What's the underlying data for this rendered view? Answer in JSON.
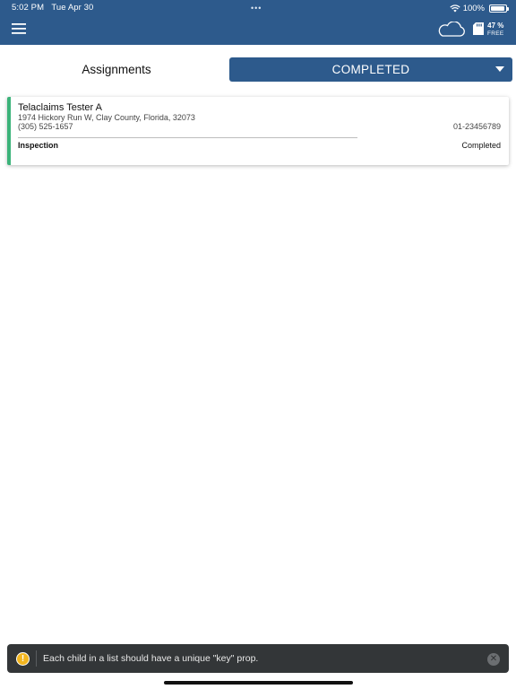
{
  "status_bar": {
    "time": "5:02 PM",
    "date": "Tue Apr 30",
    "battery": "100%",
    "wifi_icon": "wifi-icon",
    "battery_icon": "battery-icon"
  },
  "header": {
    "menu_icon": "hamburger-menu-icon",
    "cloud_icon": "cloud-sync-icon",
    "storage_icon": "sd-card-icon",
    "storage_percent": "47 %",
    "storage_label": "FREE"
  },
  "filters": {
    "assignments_label": "Assignments",
    "selected_status": "COMPLETED"
  },
  "assignments": [
    {
      "name": "Telaclaims Tester A",
      "address": "1974 Hickory Run W, Clay County, Florida, 32073",
      "phone": "(305) 525-1657",
      "claim_number": "01-23456789",
      "type": "Inspection",
      "status": "Completed"
    }
  ],
  "toast": {
    "icon": "warning-icon",
    "message": "Each child in a list should have a unique \"key\" prop.",
    "close_icon": "close-icon"
  },
  "colors": {
    "primary": "#2d5a8c",
    "card_accent": "#3cb37a",
    "toast_bg": "#333638",
    "warning": "#f2b51f"
  }
}
